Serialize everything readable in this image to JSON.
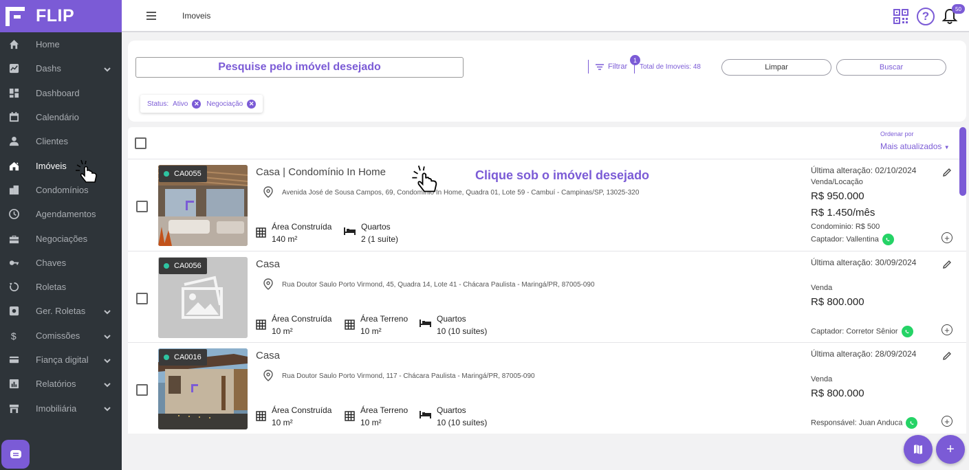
{
  "brand": {
    "name": "FLIP",
    "accent": "#7b5bd6"
  },
  "sidebar": {
    "items": [
      {
        "label": "Home",
        "icon": "home-icon"
      },
      {
        "label": "Dashs",
        "icon": "chart-icon",
        "expandable": true
      },
      {
        "label": "Dashboard",
        "icon": "dashboard-icon"
      },
      {
        "label": "Calendário",
        "icon": "calendar-icon"
      },
      {
        "label": "Clientes",
        "icon": "person-icon"
      },
      {
        "label": "Imóveis",
        "icon": "house-icon",
        "active": true
      },
      {
        "label": "Condomínios",
        "icon": "building-icon"
      },
      {
        "label": "Agendamentos",
        "icon": "clock-icon"
      },
      {
        "label": "Negociações",
        "icon": "briefcase-icon"
      },
      {
        "label": "Chaves",
        "icon": "key-icon"
      },
      {
        "label": "Roletas",
        "icon": "rotate-icon"
      },
      {
        "label": "Ger. Roletas",
        "icon": "settings-box-icon",
        "expandable": true
      },
      {
        "label": "Comissões",
        "icon": "dollar-icon",
        "expandable": true
      },
      {
        "label": "Fiança digital",
        "icon": "card-icon",
        "expandable": true
      },
      {
        "label": "Relatórios",
        "icon": "report-icon",
        "expandable": true
      },
      {
        "label": "Imobiliária",
        "icon": "store-icon",
        "expandable": true
      }
    ]
  },
  "topbar": {
    "title": "Imoveis",
    "notifications": "50"
  },
  "search": {
    "placeholder": "Pesquise pelo imóvel desejado",
    "filter_label": "Filtrar",
    "filter_count": "1",
    "total": "Total de Imoveis: 48",
    "clear_label": "Limpar",
    "search_label": "Buscar",
    "chips": {
      "status_label": "Status:",
      "values": [
        "Ativo",
        "Negociação"
      ]
    }
  },
  "list": {
    "sort_label": "Ordenar por",
    "sort_value": "Mais atualizados",
    "hint": "Clique sob o imóvel desejado",
    "properties": [
      {
        "code": "CA0055",
        "title": "Casa | Condomínio In Home",
        "address": "Avenida José de Sousa Campos, 69, Condomínio In Home, Quadra 01, Lote 59 - Cambuí - Campinas/SP, 13025-320",
        "features": [
          {
            "label": "Área Construída",
            "value": "140 m²"
          },
          {
            "label": "Quartos",
            "value": "2 (1 suíte)"
          }
        ],
        "updated": "Última alteração: 02/10/2024",
        "type": "Venda/Locação",
        "price": "R$ 950.000",
        "rent": "R$ 1.450/mês",
        "condo": "Condominio: R$ 500",
        "agent": "Captador:  Vallentina"
      },
      {
        "code": "CA0056",
        "title": "Casa",
        "address": "Rua Doutor Saulo Porto Virmond, 45, Quadra 14, Lote 41 - Chácara Paulista - Maringá/PR, 87005-090",
        "features": [
          {
            "label": "Área Construída",
            "value": "10 m²"
          },
          {
            "label": "Área Terreno",
            "value": "10 m²"
          },
          {
            "label": "Quartos",
            "value": "10 (10 suítes)"
          }
        ],
        "updated": "Última alteração: 30/09/2024",
        "type": "Venda",
        "price": "R$ 800.000",
        "agent": "Captador:  Corretor Sênior"
      },
      {
        "code": "CA0016",
        "title": "Casa",
        "address": "Rua Doutor Saulo Porto Virmond, 117 - Chácara Paulista - Maringá/PR, 87005-090",
        "features": [
          {
            "label": "Área Construída",
            "value": "10 m²"
          },
          {
            "label": "Área Terreno",
            "value": "10 m²"
          },
          {
            "label": "Quartos",
            "value": "10 (10 suítes)"
          }
        ],
        "updated": "Última alteração: 28/09/2024",
        "type": "Venda",
        "price": "R$ 800.000",
        "agent": "Responsável:  Juan Anduca"
      }
    ]
  }
}
